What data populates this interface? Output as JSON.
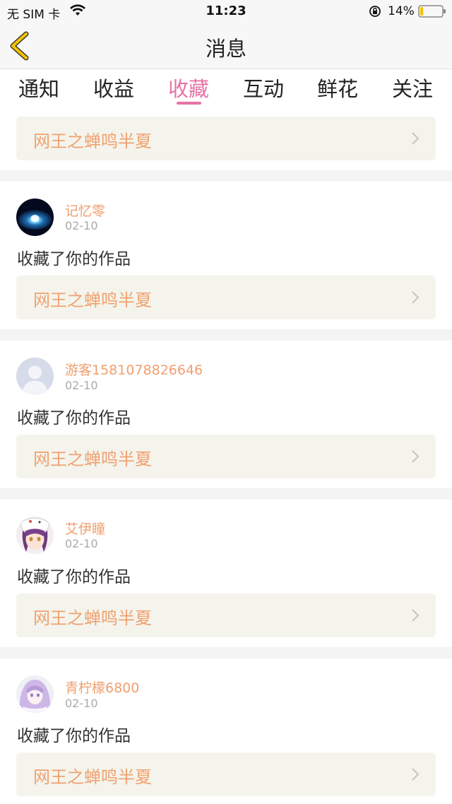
{
  "status_bar": {
    "carrier": "无 SIM 卡",
    "time": "11:23",
    "battery_percent": "14%",
    "battery_level": 0.14,
    "battery_color": "#f5c400"
  },
  "nav": {
    "title": "消息",
    "back_icon": "chevron-left-icon",
    "back_color": "#f5c400"
  },
  "tabs": [
    {
      "label": "通知",
      "active": false
    },
    {
      "label": "收益",
      "active": false
    },
    {
      "label": "收藏",
      "active": true
    },
    {
      "label": "互动",
      "active": false
    },
    {
      "label": "鲜花",
      "active": false
    },
    {
      "label": "关注",
      "active": false
    }
  ],
  "accent_color": "#e773a5",
  "partial_item": {
    "work_title": "网王之蝉鸣半夏"
  },
  "items": [
    {
      "username": "记忆零",
      "date": "02-10",
      "action": "收藏了你的作品",
      "work_title": "网王之蝉鸣半夏",
      "avatar": "galaxy-avatar"
    },
    {
      "username": "游客1581078826646",
      "date": "02-10",
      "action": "收藏了你的作品",
      "work_title": "网王之蝉鸣半夏",
      "avatar": "default-avatar"
    },
    {
      "username": "艾伊瞳",
      "date": "02-10",
      "action": "收藏了你的作品",
      "work_title": "网王之蝉鸣半夏",
      "avatar": "anime-avatar"
    },
    {
      "username": "青柠檬6800",
      "date": "02-10",
      "action": "收藏了你的作品",
      "work_title": "网王之蝉鸣半夏",
      "avatar": "anime-avatar"
    }
  ]
}
